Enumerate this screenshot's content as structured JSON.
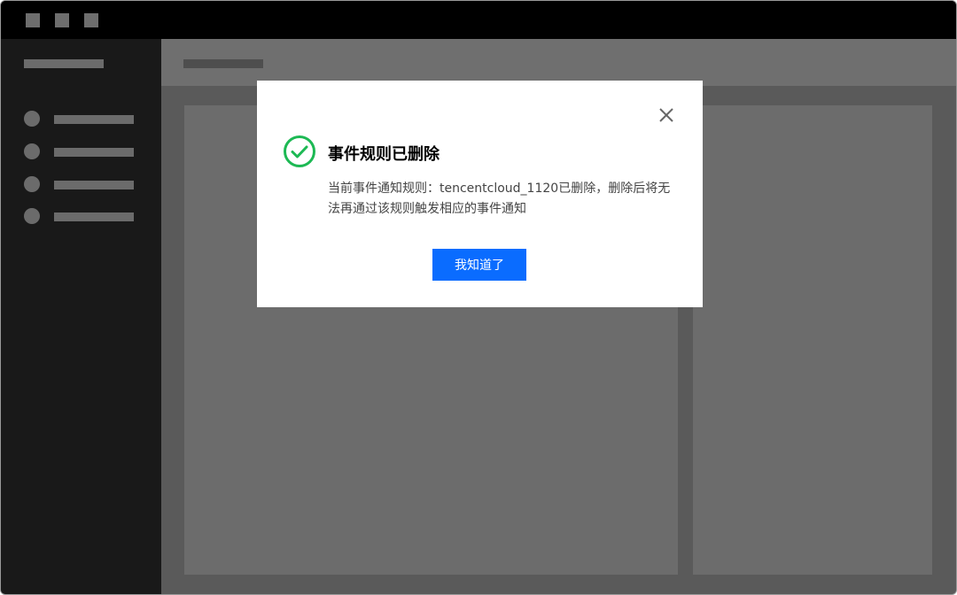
{
  "dialog": {
    "title": "事件规则已删除",
    "message": "当前事件通知规则：tencentcloud_1120已删除，删除后将无法再通过该规则触发相应的事件通知",
    "confirm_label": "我知道了",
    "success_icon": "check-circle-icon",
    "close_icon": "close-icon",
    "success_color": "#1db954",
    "button_color": "#0a6cff"
  },
  "sidebar": {
    "items": [
      {
        "icon": "nav-dot-icon"
      },
      {
        "icon": "nav-dot-icon"
      },
      {
        "icon": "nav-dot-icon"
      },
      {
        "icon": "nav-dot-icon"
      }
    ]
  }
}
